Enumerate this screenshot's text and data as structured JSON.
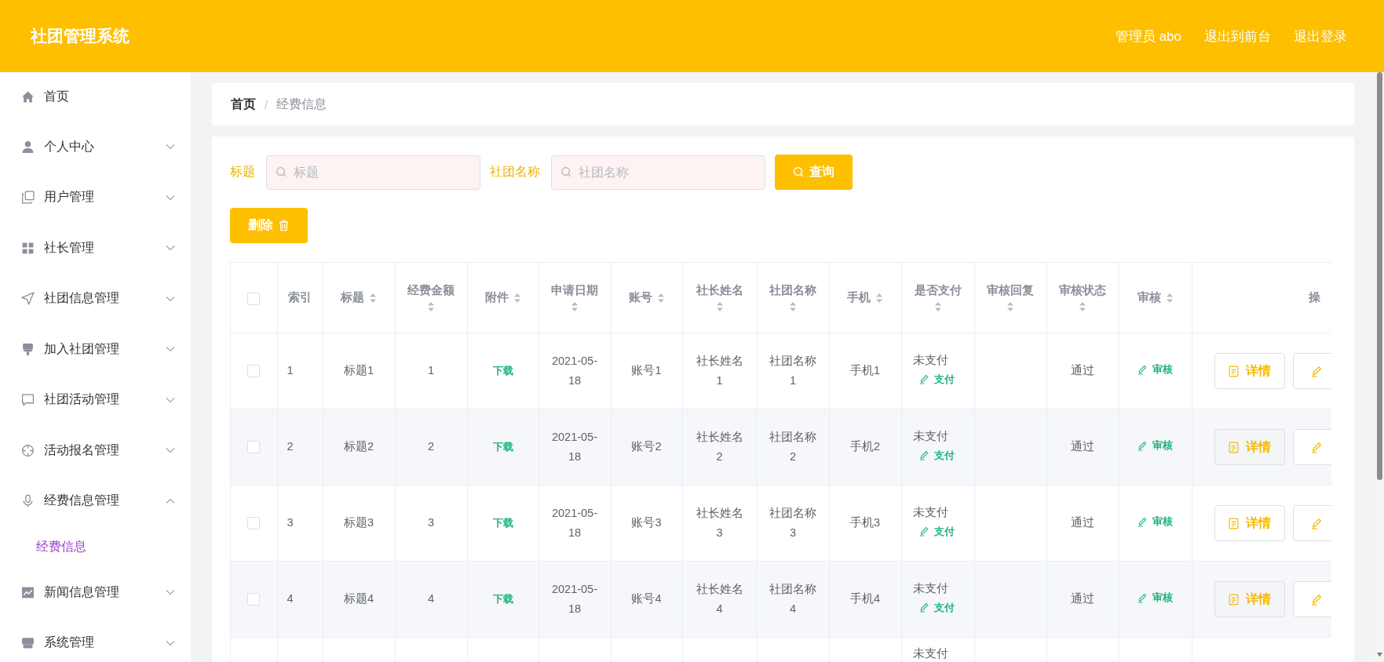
{
  "header": {
    "title": "社团管理系统",
    "links": [
      "管理员 abo",
      "退出到前台",
      "退出登录"
    ]
  },
  "sidebar": {
    "items": [
      {
        "label": "首页"
      },
      {
        "label": "个人中心",
        "expanded": false
      },
      {
        "label": "用户管理",
        "expanded": false
      },
      {
        "label": "社长管理",
        "expanded": false
      },
      {
        "label": "社团信息管理",
        "expanded": false
      },
      {
        "label": "加入社团管理",
        "expanded": false
      },
      {
        "label": "社团活动管理",
        "expanded": false
      },
      {
        "label": "活动报名管理",
        "expanded": false
      },
      {
        "label": "经费信息管理",
        "expanded": true,
        "children": [
          {
            "label": "经费信息",
            "selected": true
          }
        ]
      },
      {
        "label": "新闻信息管理",
        "expanded": false
      },
      {
        "label": "系统管理",
        "expanded": false
      }
    ]
  },
  "breadcrumb": {
    "items": [
      "首页",
      "经费信息"
    ],
    "separator": "/"
  },
  "search": {
    "fields": [
      {
        "label": "标题",
        "placeholder": "标题"
      },
      {
        "label": "社团名称",
        "placeholder": "社团名称"
      }
    ],
    "query_button": "查询",
    "delete_button": "删除"
  },
  "table": {
    "all_checked": false,
    "columns": [
      {
        "label": "索引",
        "sortable": false
      },
      {
        "label": "标题",
        "sortable": true
      },
      {
        "label": "经费金额",
        "sortable": true
      },
      {
        "label": "附件",
        "sortable": true
      },
      {
        "label": "申请日期",
        "sortable": true
      },
      {
        "label": "账号",
        "sortable": true
      },
      {
        "label": "社长姓名",
        "sortable": true
      },
      {
        "label": "社团名称",
        "sortable": true
      },
      {
        "label": "手机",
        "sortable": true
      },
      {
        "label": "是否支付",
        "sortable": true
      },
      {
        "label": "审核回复",
        "sortable": true
      },
      {
        "label": "审核状态",
        "sortable": true
      },
      {
        "label": "审核",
        "sortable": true
      },
      {
        "label": "操",
        "sortable": false
      }
    ],
    "rows": [
      {
        "checked": false,
        "index": "1",
        "title": "标题1",
        "amount": "1",
        "attachment": "下载",
        "date": "2021-05-18",
        "account": "账号1",
        "leader": "社长姓名1",
        "club": "社团名称1",
        "phone": "手机1",
        "pay_status": "未支付",
        "pay_link": "支付",
        "status": "通过",
        "audit_link": "审核",
        "detail_button": "详情"
      },
      {
        "checked": false,
        "index": "2",
        "title": "标题2",
        "amount": "2",
        "attachment": "下载",
        "date": "2021-05-18",
        "account": "账号2",
        "leader": "社长姓名2",
        "club": "社团名称2",
        "phone": "手机2",
        "pay_status": "未支付",
        "pay_link": "支付",
        "status": "通过",
        "audit_link": "审核",
        "detail_button": "详情"
      },
      {
        "checked": false,
        "index": "3",
        "title": "标题3",
        "amount": "3",
        "attachment": "下载",
        "date": "2021-05-18",
        "account": "账号3",
        "leader": "社长姓名3",
        "club": "社团名称3",
        "phone": "手机3",
        "pay_status": "未支付",
        "pay_link": "支付",
        "status": "通过",
        "audit_link": "审核",
        "detail_button": "详情"
      },
      {
        "checked": false,
        "index": "4",
        "title": "标题4",
        "amount": "4",
        "attachment": "下载",
        "date": "2021-05-18",
        "account": "账号4",
        "leader": "社长姓名4",
        "club": "社团名称4",
        "phone": "手机4",
        "pay_status": "未支付",
        "pay_link": "支付",
        "status": "通过",
        "audit_link": "审核",
        "detail_button": "详情"
      }
    ],
    "partial_row": {
      "pay_status": "未支付"
    }
  }
}
